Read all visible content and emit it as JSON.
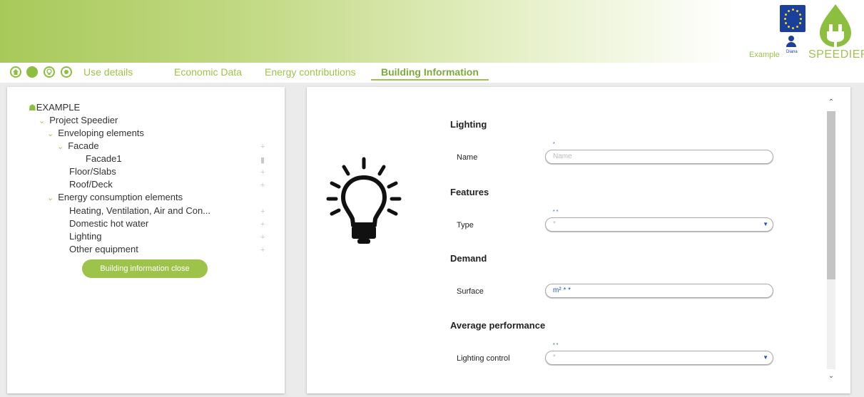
{
  "header": {
    "user_name": "Diana",
    "example_label": "Example",
    "logo_text": "SPEEDIER",
    "accent_color": "#9ec34b",
    "brand_blue": "#1b3f9c"
  },
  "nav": {
    "icons": [
      "home-icon",
      "globe-icon",
      "bulb-icon",
      "target-icon"
    ],
    "tabs": [
      "Use details",
      "Economic Data",
      "Energy contributions",
      "Building Information"
    ],
    "active_tab": "Building Information"
  },
  "tree": {
    "root": "EXAMPLE",
    "project": "Project Speedier",
    "enveloping": "Enveloping elements",
    "facade": "Facade",
    "facade1": "Facade1",
    "floor": "Floor/Slabs",
    "roof": "Roof/Deck",
    "energy": "Energy consumption elements",
    "hvac": "Heating, Ventilation, Air and Con...",
    "dhw": "Domestic hot water",
    "lighting": "Lighting",
    "other": "Other equipment",
    "close_button": "Building information close"
  },
  "form": {
    "section_lighting": "Lighting",
    "name_label": "Name",
    "name_required": "*",
    "name_placeholder": "Name",
    "section_features": "Features",
    "type_label": "Type",
    "type_note": "* *",
    "type_value": "*",
    "section_demand": "Demand",
    "surface_label": "Surface",
    "surface_value": "m² * *",
    "section_performance": "Average performance",
    "control_label": "Lighting control",
    "control_note": "* *",
    "control_value": "*"
  }
}
